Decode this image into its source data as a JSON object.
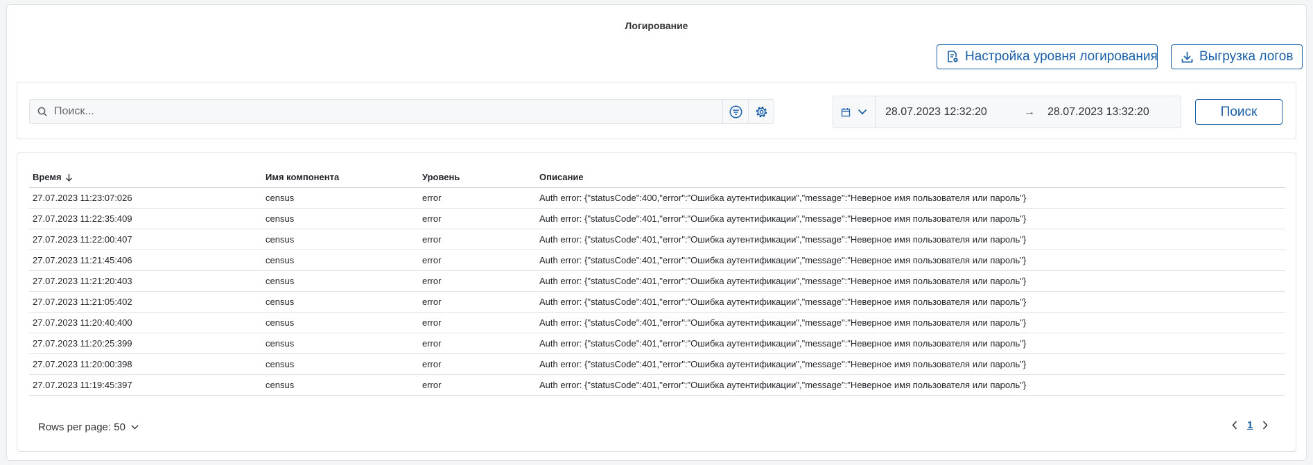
{
  "header": {
    "title": "Логирование",
    "log_level_button": "Настройка уровня логирования",
    "export_button": "Выгрузка логов"
  },
  "filter": {
    "search_placeholder": "Поиск...",
    "search_value": "",
    "date_from": "28.07.2023 12:32:20",
    "date_arrow": "→",
    "date_to": "28.07.2023 13:32:20",
    "search_button": "Поиск"
  },
  "table": {
    "columns": [
      "Время",
      "Имя компонента",
      "Уровень",
      "Описание"
    ],
    "sort_column": "Время",
    "sort_direction": "desc",
    "rows": [
      {
        "time": "27.07.2023 11:23:07:026",
        "component": "census",
        "level": "error",
        "description": "Auth error: {\"statusCode\":400,\"error\":\"Ошибка аутентификации\",\"message\":\"Неверное имя пользователя или пароль\"}"
      },
      {
        "time": "27.07.2023 11:22:35:409",
        "component": "census",
        "level": "error",
        "description": "Auth error: {\"statusCode\":401,\"error\":\"Ошибка аутентификации\",\"message\":\"Неверное имя пользователя или пароль\"}"
      },
      {
        "time": "27.07.2023 11:22:00:407",
        "component": "census",
        "level": "error",
        "description": "Auth error: {\"statusCode\":401,\"error\":\"Ошибка аутентификации\",\"message\":\"Неверное имя пользователя или пароль\"}"
      },
      {
        "time": "27.07.2023 11:21:45:406",
        "component": "census",
        "level": "error",
        "description": "Auth error: {\"statusCode\":401,\"error\":\"Ошибка аутентификации\",\"message\":\"Неверное имя пользователя или пароль\"}"
      },
      {
        "time": "27.07.2023 11:21:20:403",
        "component": "census",
        "level": "error",
        "description": "Auth error: {\"statusCode\":401,\"error\":\"Ошибка аутентификации\",\"message\":\"Неверное имя пользователя или пароль\"}"
      },
      {
        "time": "27.07.2023 11:21:05:402",
        "component": "census",
        "level": "error",
        "description": "Auth error: {\"statusCode\":401,\"error\":\"Ошибка аутентификации\",\"message\":\"Неверное имя пользователя или пароль\"}"
      },
      {
        "time": "27.07.2023 11:20:40:400",
        "component": "census",
        "level": "error",
        "description": "Auth error: {\"statusCode\":401,\"error\":\"Ошибка аутентификации\",\"message\":\"Неверное имя пользователя или пароль\"}"
      },
      {
        "time": "27.07.2023 11:20:25:399",
        "component": "census",
        "level": "error",
        "description": "Auth error: {\"statusCode\":401,\"error\":\"Ошибка аутентификации\",\"message\":\"Неверное имя пользователя или пароль\"}"
      },
      {
        "time": "27.07.2023 11:20:00:398",
        "component": "census",
        "level": "error",
        "description": "Auth error: {\"statusCode\":401,\"error\":\"Ошибка аутентификации\",\"message\":\"Неверное имя пользователя или пароль\"}"
      },
      {
        "time": "27.07.2023 11:19:45:397",
        "component": "census",
        "level": "error",
        "description": "Auth error: {\"statusCode\":401,\"error\":\"Ошибка аутентификации\",\"message\":\"Неверное имя пользователя или пароль\"}"
      }
    ]
  },
  "pagination": {
    "rows_per_page_label": "Rows per page: 50",
    "current_page": "1"
  },
  "icons": {
    "log_settings": "document-gear-icon",
    "export": "download-icon",
    "search": "search-icon",
    "filter": "filter-icon",
    "settings": "gear-icon",
    "calendar": "calendar-icon",
    "sort": "arrow-down-icon"
  },
  "colors": {
    "accent": "#1a5fa8",
    "border": "#dfe3e8",
    "background": "#f4f5f7"
  }
}
